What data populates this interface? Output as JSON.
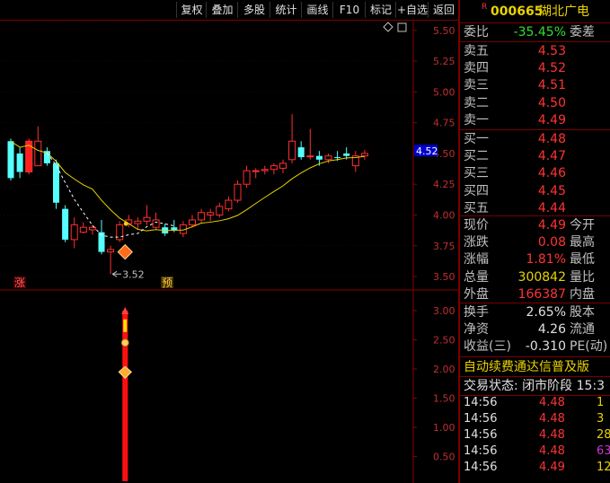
{
  "toolbar": {
    "buttons": [
      "复权",
      "叠加",
      "多股",
      "统计",
      "画线",
      "F10",
      "标记",
      "+自选",
      "返回"
    ]
  },
  "stock": {
    "badge": "R",
    "code": "000665",
    "name": "湖北广电"
  },
  "quote": {
    "weibi_label": "委比",
    "weibi_value": "-35.45%",
    "weicha_label": "委差",
    "asks": [
      {
        "label": "卖五",
        "price": "4.53"
      },
      {
        "label": "卖四",
        "price": "4.52"
      },
      {
        "label": "卖三",
        "price": "4.51"
      },
      {
        "label": "卖二",
        "price": "4.50"
      },
      {
        "label": "卖一",
        "price": "4.49"
      }
    ],
    "bids": [
      {
        "label": "买一",
        "price": "4.48"
      },
      {
        "label": "买二",
        "price": "4.47"
      },
      {
        "label": "买三",
        "price": "4.46"
      },
      {
        "label": "买四",
        "price": "4.45"
      },
      {
        "label": "买五",
        "price": "4.44"
      }
    ],
    "stats": [
      {
        "label": "现价",
        "value": "4.49",
        "label2": "今开",
        "color": "#ff3333"
      },
      {
        "label": "涨跌",
        "value": "0.08",
        "label2": "最高",
        "color": "#ff3333"
      },
      {
        "label": "涨幅",
        "value": "1.81%",
        "label2": "最低",
        "color": "#ff3333"
      },
      {
        "label": "总量",
        "value": "300842",
        "label2": "量比",
        "color": "#e8d200"
      },
      {
        "label": "外盘",
        "value": "166387",
        "label2": "内盘",
        "color": "#ff3333"
      }
    ],
    "stats2": [
      {
        "label": "换手",
        "value": "2.65%",
        "label2": "股本",
        "color": "#e0e0e0"
      },
      {
        "label": "净资",
        "value": "4.26",
        "label2": "流通",
        "color": "#e0e0e0"
      },
      {
        "label": "收益(三)",
        "value": "-0.310",
        "label2": "PE(动)",
        "color": "#e0e0e0"
      }
    ],
    "ad_text": "自动续费通达信普及版",
    "trade_status": "交易状态: 闭市阶段 15:3",
    "ticks": [
      {
        "time": "14:56",
        "price": "4.48",
        "vol": "1",
        "vcolor": "#e8d200"
      },
      {
        "time": "14:56",
        "price": "4.48",
        "vol": "3",
        "vcolor": "#e8d200"
      },
      {
        "time": "14:56",
        "price": "4.48",
        "vol": "28",
        "vcolor": "#e8d200"
      },
      {
        "time": "14:56",
        "price": "4.48",
        "vol": "63",
        "vcolor": "#cc33cc"
      },
      {
        "time": "14:56",
        "price": "4.49",
        "vol": "12",
        "vcolor": "#e8d200"
      }
    ]
  },
  "chart_data": [
    {
      "type": "candlestick",
      "y_ticks": [
        "5.50",
        "5.25",
        "5.00",
        "4.75",
        "4.50",
        "4.25",
        "4.00",
        "3.75",
        "3.50"
      ],
      "ylim": [
        3.42,
        5.55
      ],
      "current_price_label": "4.52",
      "low_marker_label": "3.52",
      "markers": [
        "涨",
        "预"
      ],
      "candles": [
        {
          "o": 4.3,
          "h": 4.62,
          "l": 4.28,
          "c": 4.6,
          "up": false
        },
        {
          "o": 4.35,
          "h": 4.55,
          "l": 4.3,
          "c": 4.5,
          "up": false
        },
        {
          "o": 4.35,
          "h": 4.62,
          "l": 4.33,
          "c": 4.6,
          "up": true
        },
        {
          "o": 4.6,
          "h": 4.72,
          "l": 4.4,
          "c": 4.4,
          "up": true
        },
        {
          "o": 4.52,
          "h": 4.55,
          "l": 4.4,
          "c": 4.42,
          "up": false
        },
        {
          "o": 4.42,
          "h": 4.45,
          "l": 4.05,
          "c": 4.1,
          "up": false
        },
        {
          "o": 4.05,
          "h": 4.08,
          "l": 3.78,
          "c": 3.8,
          "up": false
        },
        {
          "o": 3.8,
          "h": 3.98,
          "l": 3.73,
          "c": 3.92,
          "up": true
        },
        {
          "o": 3.9,
          "h": 3.94,
          "l": 3.85,
          "c": 3.86,
          "up": true
        },
        {
          "o": 3.88,
          "h": 3.92,
          "l": 3.84,
          "c": 3.9,
          "up": true
        },
        {
          "o": 3.86,
          "h": 3.96,
          "l": 3.68,
          "c": 3.7,
          "up": false
        },
        {
          "o": 3.7,
          "h": 3.75,
          "l": 3.52,
          "c": 3.72,
          "up": true
        },
        {
          "o": 3.8,
          "h": 3.95,
          "l": 3.78,
          "c": 3.92,
          "up": true
        },
        {
          "o": 3.93,
          "h": 4.0,
          "l": 3.9,
          "c": 3.96,
          "up": true
        },
        {
          "o": 3.93,
          "h": 3.98,
          "l": 3.88,
          "c": 3.95,
          "up": true
        },
        {
          "o": 3.95,
          "h": 4.08,
          "l": 3.92,
          "c": 3.98,
          "up": true
        },
        {
          "o": 3.96,
          "h": 4.02,
          "l": 3.88,
          "c": 3.9,
          "up": true
        },
        {
          "o": 3.9,
          "h": 3.93,
          "l": 3.83,
          "c": 3.85,
          "up": false
        },
        {
          "o": 3.9,
          "h": 3.96,
          "l": 3.86,
          "c": 3.88,
          "up": false
        },
        {
          "o": 3.85,
          "h": 3.95,
          "l": 3.82,
          "c": 3.92,
          "up": true
        },
        {
          "o": 3.92,
          "h": 4.0,
          "l": 3.9,
          "c": 3.96,
          "up": true
        },
        {
          "o": 3.96,
          "h": 4.05,
          "l": 3.94,
          "c": 4.02,
          "up": true
        },
        {
          "o": 4.02,
          "h": 4.05,
          "l": 3.95,
          "c": 4.0,
          "up": true
        },
        {
          "o": 4.0,
          "h": 4.1,
          "l": 3.98,
          "c": 4.07,
          "up": true
        },
        {
          "o": 4.05,
          "h": 4.15,
          "l": 4.03,
          "c": 4.12,
          "up": true
        },
        {
          "o": 4.12,
          "h": 4.28,
          "l": 4.1,
          "c": 4.25,
          "up": true
        },
        {
          "o": 4.25,
          "h": 4.4,
          "l": 4.22,
          "c": 4.36,
          "up": true
        },
        {
          "o": 4.36,
          "h": 4.38,
          "l": 4.3,
          "c": 4.36,
          "up": true
        },
        {
          "o": 4.36,
          "h": 4.4,
          "l": 4.33,
          "c": 4.37,
          "up": true
        },
        {
          "o": 4.37,
          "h": 4.42,
          "l": 4.33,
          "c": 4.4,
          "up": true
        },
        {
          "o": 4.38,
          "h": 4.45,
          "l": 4.34,
          "c": 4.42,
          "up": true
        },
        {
          "o": 4.45,
          "h": 4.82,
          "l": 4.42,
          "c": 4.6,
          "up": true
        },
        {
          "o": 4.55,
          "h": 4.6,
          "l": 4.45,
          "c": 4.47,
          "up": false
        },
        {
          "o": 4.48,
          "h": 4.7,
          "l": 4.45,
          "c": 4.48,
          "up": true
        },
        {
          "o": 4.48,
          "h": 4.52,
          "l": 4.4,
          "c": 4.45,
          "up": false
        },
        {
          "o": 4.45,
          "h": 4.5,
          "l": 4.42,
          "c": 4.48,
          "up": true
        },
        {
          "o": 4.47,
          "h": 4.52,
          "l": 4.44,
          "c": 4.47,
          "up": false
        },
        {
          "o": 4.48,
          "h": 4.55,
          "l": 4.45,
          "c": 4.5,
          "up": false
        },
        {
          "o": 4.48,
          "h": 4.52,
          "l": 4.35,
          "c": 4.4,
          "up": true
        },
        {
          "o": 4.48,
          "h": 4.53,
          "l": 4.45,
          "c": 4.5,
          "up": true
        }
      ]
    },
    {
      "type": "indicator",
      "y_ticks": [
        "3.00",
        "2.50",
        "2.00",
        "1.50",
        "1.00",
        "0.50"
      ],
      "ylim": [
        0.2,
        3.2
      ]
    }
  ]
}
